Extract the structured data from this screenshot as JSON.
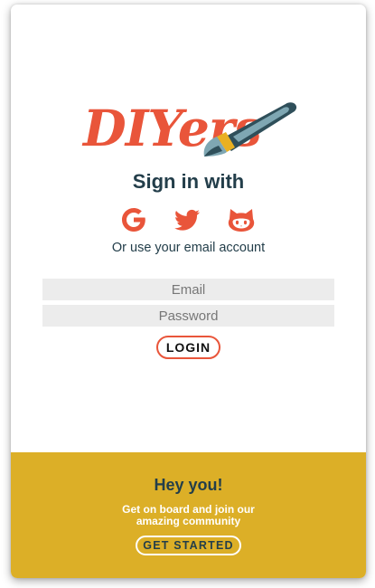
{
  "brand": {
    "logo_text": "DIYers",
    "logo_icon": "paintbrush-icon"
  },
  "signin": {
    "title": "Sign in with",
    "social": [
      {
        "name": "google",
        "icon": "google-icon"
      },
      {
        "name": "twitter",
        "icon": "twitter-icon"
      },
      {
        "name": "github",
        "icon": "github-icon"
      }
    ],
    "alt_text": "Or use your email account"
  },
  "form": {
    "email_placeholder": "Email",
    "password_placeholder": "Password",
    "login_label": "LOGIN"
  },
  "footer": {
    "heading": "Hey you!",
    "text": "Get on board and join our amazing community",
    "button_label": "GET STARTED"
  },
  "colors": {
    "accent": "#e9553a",
    "footer_bg": "#dcaf27",
    "dark_text": "#233e4a",
    "brush_teal": "#2f4f5a",
    "input_bg": "#ececec"
  }
}
